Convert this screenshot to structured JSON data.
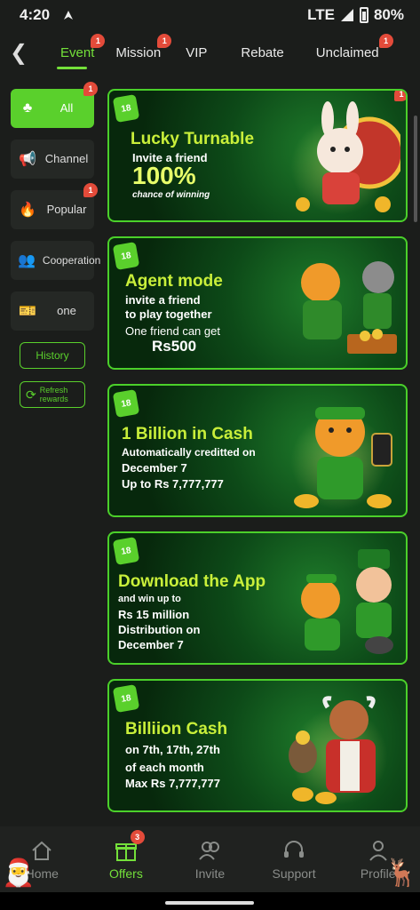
{
  "status": {
    "time": "4:20",
    "network": "LTE",
    "battery": "80%"
  },
  "topnav": {
    "tabs": [
      {
        "label": "Event",
        "badge": "1",
        "active": true
      },
      {
        "label": "Mission",
        "badge": "1"
      },
      {
        "label": "VIP",
        "badge": ""
      },
      {
        "label": "Rebate",
        "badge": ""
      },
      {
        "label": "Unclaimed",
        "badge": "1"
      }
    ]
  },
  "sidebar": {
    "items": [
      {
        "label": "All",
        "badge": "1",
        "icon": "cards-icon"
      },
      {
        "label": "Channel",
        "badge": "",
        "icon": "megaphone-icon"
      },
      {
        "label": "Popular",
        "badge": "1",
        "icon": "fire-icon"
      },
      {
        "label": "Cooperation",
        "badge": "",
        "icon": "handshake-icon"
      },
      {
        "label": "one",
        "badge": "",
        "icon": "ticket-icon"
      }
    ],
    "history_label": "History",
    "refresh_label_1": "Refresh",
    "refresh_label_2": "rewards"
  },
  "cards": [
    {
      "badge": "1",
      "title": "Lucky Turnable",
      "l1": "Invite a friend",
      "l2": "100%",
      "l3": "chance of winning"
    },
    {
      "title": "Agent mode",
      "l1": "invite a friend",
      "l2": "to play together",
      "l3": "One friend can get",
      "l4": "Rs500"
    },
    {
      "title": "1 Billion in Cash",
      "l1": "Automatically creditted on",
      "l2": "December 7",
      "l3": "Up to Rs 7,777,777"
    },
    {
      "title": "Download the App",
      "l1": "and win up to",
      "l2": "Rs 15 million",
      "l3": "Distribution on",
      "l4": "December 7"
    },
    {
      "title": "Billiion Cash",
      "l1": "on 7th, 17th, 27th",
      "l2": "of each month",
      "l3": "Max Rs 7,777,777"
    }
  ],
  "bottomnav": [
    {
      "label": "Home"
    },
    {
      "label": "Offers",
      "badge": "3",
      "active": true
    },
    {
      "label": "Invite"
    },
    {
      "label": "Support"
    },
    {
      "label": "Profile"
    }
  ],
  "colors": {
    "accent": "#5ad02c",
    "badge": "#e34b3a",
    "background": "#1b1d1b"
  }
}
